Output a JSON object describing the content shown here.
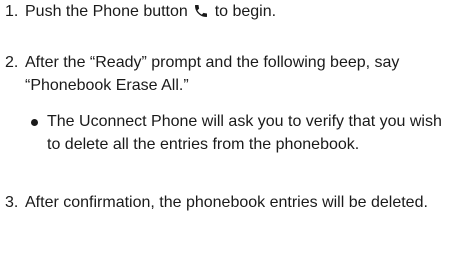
{
  "steps": [
    {
      "number": "1.",
      "text_before_icon": "Push the Phone button ",
      "icon": "phone-icon",
      "text_after_icon": " to begin."
    },
    {
      "number": "2.",
      "text": "After the “Ready” prompt and the following beep, say “Phonebook Erase All.”",
      "bullet": "The Uconnect Phone will ask you to verify that you wish to delete all the entries from the phonebook."
    },
    {
      "number": "3.",
      "text": "After confirmation, the phonebook entries will be deleted."
    }
  ]
}
